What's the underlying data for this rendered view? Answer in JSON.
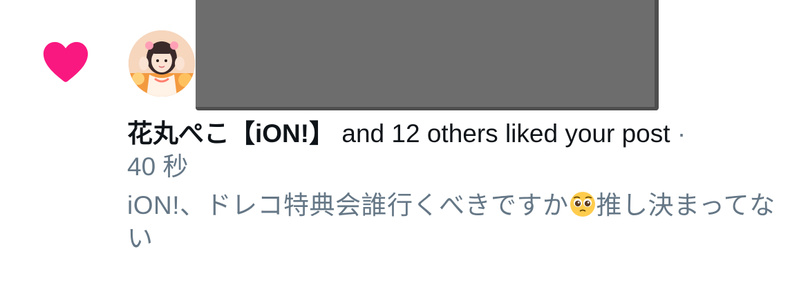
{
  "notification": {
    "type_icon": "heart-icon",
    "avatar_icon": "avatar",
    "actor_name": "花丸ぺこ【iON!】",
    "action_text": " and 12 others liked your post ",
    "separator": "·",
    "timestamp": "40 秒",
    "post_text_before_emoji": "iON!、ドレコ特典会誰行くべきですか",
    "emoji": "pleading-face-emoji",
    "post_text_after_emoji": "推し決まってない"
  },
  "colors": {
    "heart": "#f91880",
    "primary_text": "#0f1419",
    "secondary_text": "#657786",
    "redaction": "#6d6d6d"
  }
}
